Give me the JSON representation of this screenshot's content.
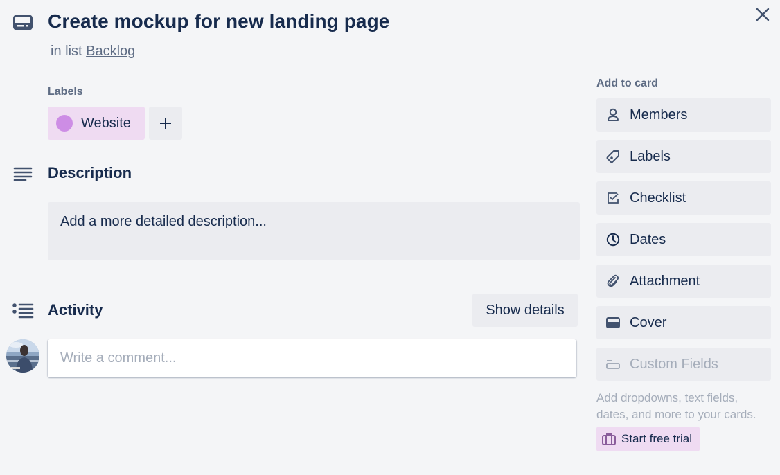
{
  "header": {
    "title": "Create mockup for new landing page",
    "in_list_prefix": "in list",
    "list_name": "Backlog",
    "card_icon": "card-icon",
    "close_icon": "close-icon"
  },
  "labels": {
    "heading": "Labels",
    "items": [
      {
        "text": "Website",
        "color": "#cd8de5",
        "bg": "#efdbf2"
      }
    ],
    "add_icon": "plus-icon"
  },
  "description": {
    "heading": "Description",
    "placeholder": "Add a more detailed description..."
  },
  "activity": {
    "heading": "Activity",
    "show_details_label": "Show details",
    "comment_placeholder": "Write a comment..."
  },
  "sidebar": {
    "heading": "Add to card",
    "buttons": [
      {
        "label": "Members",
        "icon": "member-icon",
        "disabled": false
      },
      {
        "label": "Labels",
        "icon": "label-icon",
        "disabled": false
      },
      {
        "label": "Checklist",
        "icon": "checklist-icon",
        "disabled": false
      },
      {
        "label": "Dates",
        "icon": "clock-icon",
        "disabled": false
      },
      {
        "label": "Attachment",
        "icon": "paperclip-icon",
        "disabled": false
      },
      {
        "label": "Cover",
        "icon": "cover-icon",
        "disabled": false
      },
      {
        "label": "Custom Fields",
        "icon": "custom-fields-icon",
        "disabled": true
      }
    ],
    "upsell_text": "Add dropdowns, text fields, dates, and more to your cards.",
    "trial_label": "Start free trial",
    "trial_icon": "briefcase-icon"
  },
  "colors": {
    "background": "#f4f5f7",
    "button_bg": "#ebecf0",
    "text_primary": "#172b4d",
    "text_secondary": "#5e6c84",
    "text_disabled": "#a5adba",
    "label_purple": "#cd8de5",
    "trial_bg": "#efdbf2"
  }
}
